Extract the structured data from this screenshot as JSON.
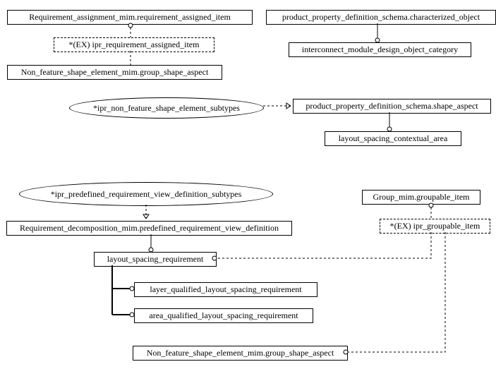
{
  "nodes": {
    "req_assign": "Requirement_assignment_mim.requirement_assigned_item",
    "ex_ipr_req": "*(EX) ipr_requirement_assigned_item",
    "nfse_group_top": "Non_feature_shape_element_mim.group_shape_aspect",
    "ppds_char": "product_property_definition_schema.characterized_object",
    "imdoc": "interconnect_module_design_object_category",
    "ipr_nfse_subtypes": "*ipr_non_feature_shape_element_subtypes",
    "ppds_shape": "product_property_definition_schema.shape_aspect",
    "layout_ctx": "layout_spacing_contextual_area",
    "ipr_predef_subtypes": "*ipr_predefined_requirement_view_definition_subtypes",
    "req_decomp": "Requirement_decomposition_mim.predefined_requirement_view_definition",
    "layout_spacing_req": "layout_spacing_requirement",
    "layer_qual": "layer_qualified_layout_spacing_requirement",
    "area_qual": "area_qualified_layout_spacing_requirement",
    "group_mim": "Group_mim.groupable_item",
    "ex_ipr_group": "*(EX) ipr_groupable_item",
    "nfse_group_bottom": "Non_feature_shape_element_mim.group_shape_aspect"
  }
}
